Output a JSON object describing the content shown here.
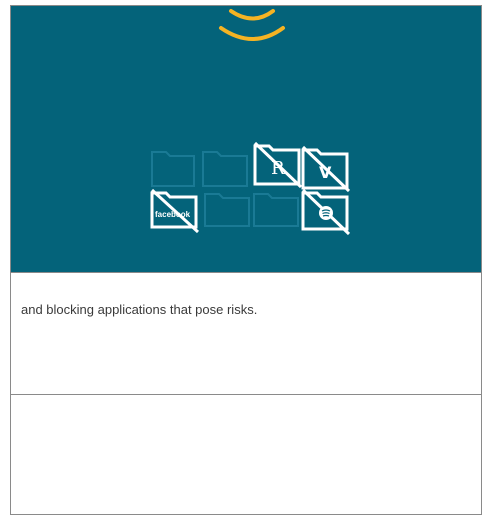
{
  "hero": {
    "background": "#04637a",
    "accent": "#f5b323",
    "blocked_apps": [
      {
        "name": "facebook",
        "label": "facebook",
        "icon": "facebook-icon"
      },
      {
        "name": "r-app",
        "label": "R",
        "icon": "r-letter-icon"
      },
      {
        "name": "vine",
        "label": "V",
        "icon": "vine-icon"
      },
      {
        "name": "spotify",
        "icon": "spotify-icon"
      }
    ]
  },
  "content": {
    "text": "and blocking applications that pose risks."
  }
}
